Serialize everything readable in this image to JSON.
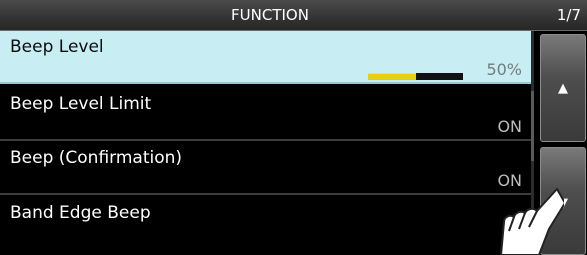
{
  "header": {
    "title": "FUNCTION",
    "page": "1/7"
  },
  "items": [
    {
      "label": "Beep Level",
      "value": "50%",
      "level": 0.5
    },
    {
      "label": "Beep Level Limit",
      "value": "ON"
    },
    {
      "label": "Beep (Confirmation)",
      "value": "ON"
    },
    {
      "label": "Band Edge Beep",
      "value": ""
    }
  ],
  "nav": {
    "up_icon": "triangle-up",
    "down_icon": "triangle-down"
  },
  "colors": {
    "selected_row": "#c8eef4",
    "level_fill": "#e8cf12"
  }
}
